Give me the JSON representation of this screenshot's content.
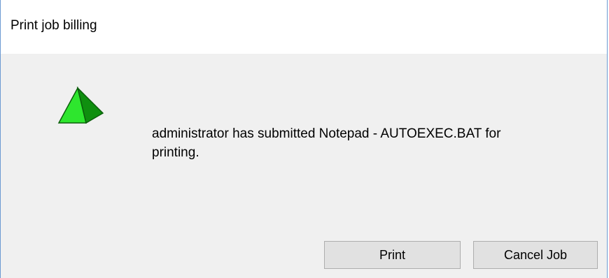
{
  "window": {
    "title": "Print job billing"
  },
  "dialog": {
    "icon": "green-pyramid-icon",
    "message_line1": "administrator has submitted Notepad - AUTOEXEC.BAT for",
    "message_line2": "printing."
  },
  "buttons": {
    "print_label": "Print",
    "cancel_label": "Cancel Job"
  },
  "colors": {
    "window_border": "#6b9ad2",
    "dialog_background": "#f0f0f0",
    "titlebar_background": "#ffffff",
    "button_face": "#e1e1e1",
    "button_border": "#adadad",
    "icon_green_light": "#33ff33",
    "icon_green_dark": "#119911"
  }
}
